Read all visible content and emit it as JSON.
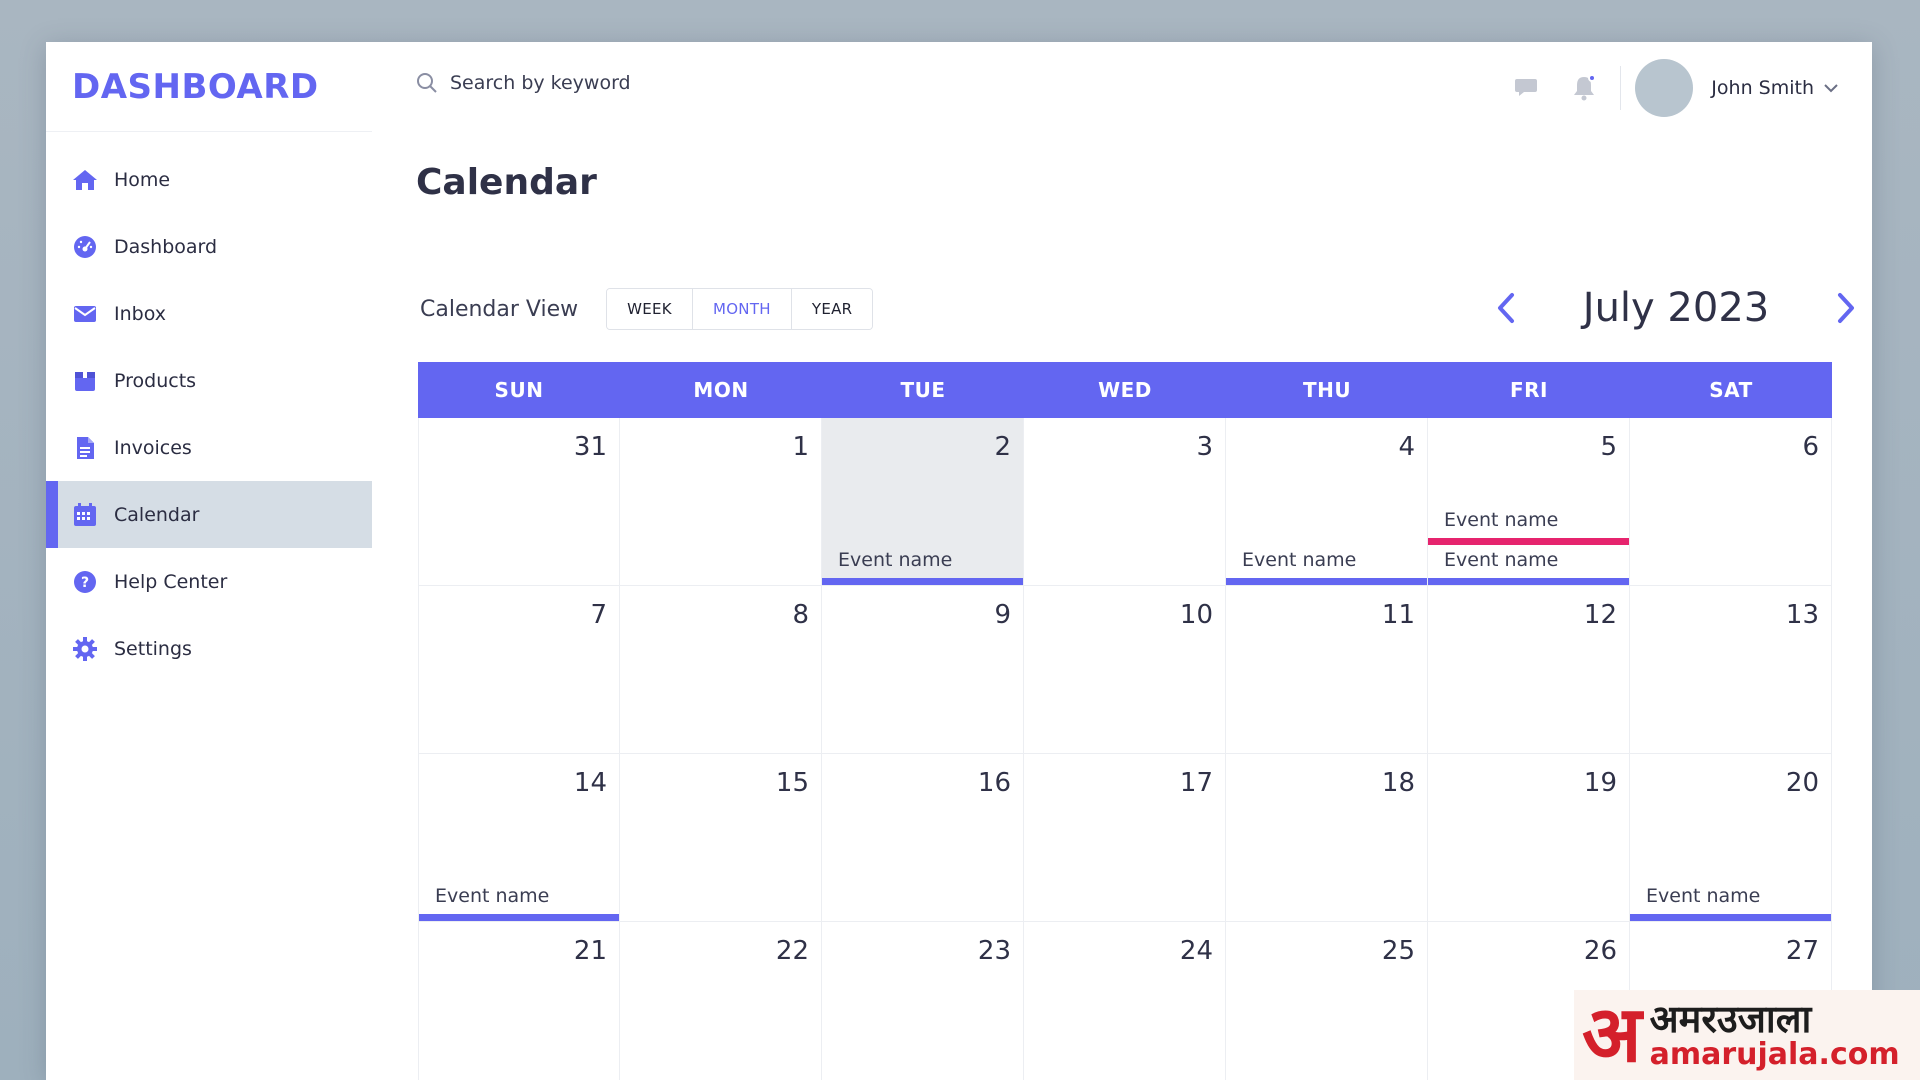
{
  "brand": "DASHBOARD",
  "sidebar": {
    "items": [
      {
        "label": "Home",
        "icon": "home-icon"
      },
      {
        "label": "Dashboard",
        "icon": "gauge-icon"
      },
      {
        "label": "Inbox",
        "icon": "mail-icon"
      },
      {
        "label": "Products",
        "icon": "box-icon"
      },
      {
        "label": "Invoices",
        "icon": "document-icon"
      },
      {
        "label": "Calendar",
        "icon": "calendar-icon",
        "active": true
      },
      {
        "label": "Help Center",
        "icon": "help-icon"
      },
      {
        "label": "Settings",
        "icon": "gear-icon"
      }
    ]
  },
  "topbar": {
    "search_placeholder": "Search by keyword",
    "user_name": "John Smith"
  },
  "page": {
    "title": "Calendar",
    "view_label": "Calendar View",
    "views": [
      "WEEK",
      "MONTH",
      "YEAR"
    ],
    "active_view": "MONTH",
    "month_label": "July 2023"
  },
  "calendar": {
    "weekdays": [
      "SUN",
      "MON",
      "TUE",
      "WED",
      "THU",
      "FRI",
      "SAT"
    ],
    "weeks": [
      [
        "31",
        "1",
        "2",
        "3",
        "4",
        "5",
        "6"
      ],
      [
        "7",
        "8",
        "9",
        "10",
        "11",
        "12",
        "13"
      ],
      [
        "14",
        "15",
        "16",
        "17",
        "18",
        "19",
        "20"
      ],
      [
        "21",
        "22",
        "23",
        "24",
        "25",
        "26",
        "27"
      ]
    ],
    "highlighted_day": "2",
    "events": [
      {
        "day": "2",
        "label": "Event name",
        "color": "#6366f1",
        "slot": 1
      },
      {
        "day": "4",
        "label": "Event name",
        "color": "#6366f1",
        "slot": 1
      },
      {
        "day": "5",
        "label": "Event name",
        "color": "#e6246e",
        "slot": 2
      },
      {
        "day": "5",
        "label": "Event name",
        "color": "#6366f1",
        "slot": 1
      },
      {
        "day": "14",
        "label": "Event name",
        "color": "#6366f1",
        "slot": 1
      },
      {
        "day": "20",
        "label": "Event name",
        "color": "#6366f1",
        "slot": 1
      }
    ]
  },
  "watermark": {
    "glyph": "अ",
    "hindi": "अमरउजाला",
    "domain": "amarujala.com"
  },
  "colors": {
    "accent": "#6366f1",
    "event_pink": "#e6246e",
    "text": "#2f3147",
    "sidebar_active": "#d5dde5"
  }
}
